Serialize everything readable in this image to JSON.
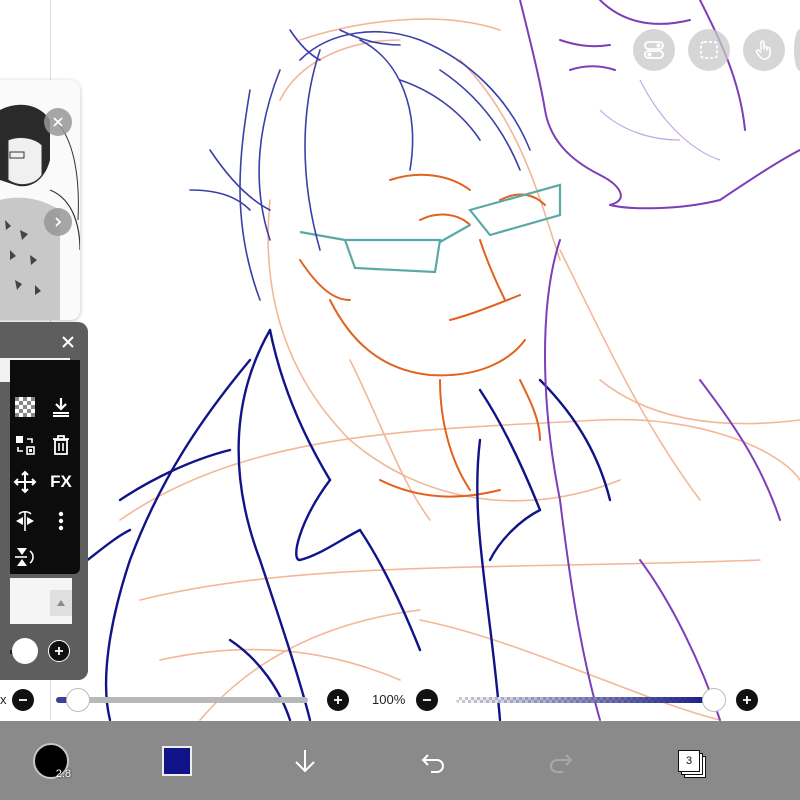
{
  "app": {
    "name": "drawing-canvas"
  },
  "colors": {
    "accent_navy": "#101488",
    "sketch_orange": "#e0631f",
    "sketch_peach": "#f2b08c",
    "sketch_purple": "#7b3fb8",
    "glasses_teal": "#5aa8a8",
    "toolbar_gray": "#8a8a8a"
  },
  "top_buttons": [
    {
      "icon": "toggle-icon"
    },
    {
      "icon": "selection-icon"
    },
    {
      "icon": "touch-hand-icon"
    }
  ],
  "reference_panel": {
    "close_icon": "close-icon",
    "next_icon": "chevron-right-icon"
  },
  "layer_panel": {
    "close_icon": "close-icon",
    "tools": [
      {
        "icon": "checkerboard-icon"
      },
      {
        "icon": "download-icon"
      },
      {
        "icon": "swap-layers-icon"
      },
      {
        "icon": "trash-icon"
      },
      {
        "icon": "move-icon"
      },
      {
        "label": "FX"
      },
      {
        "icon": "flip-horizontal-icon"
      },
      {
        "icon": "more-vertical-icon"
      },
      {
        "icon": "flip-vertical-icon"
      }
    ]
  },
  "sliders": {
    "size_label": "x",
    "size_fraction": 0.04,
    "opacity_label": "100%",
    "opacity_fraction": 1.0
  },
  "toolbar": {
    "brush_size": "2.8",
    "color": "#101488",
    "layers_count": "3"
  }
}
